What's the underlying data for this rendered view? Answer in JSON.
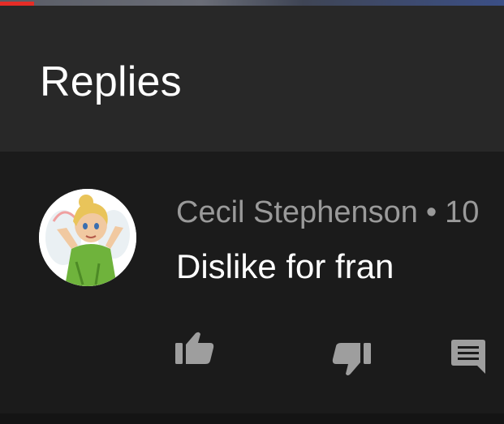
{
  "header": {
    "title": "Replies"
  },
  "reply": {
    "author": "Cecil Stephenson",
    "separator": "•",
    "time_partial": "10",
    "text": "Dislike for fran",
    "avatar_icon": "cartoon-fairy-avatar"
  },
  "actions": {
    "like_icon": "thumbs-up-icon",
    "dislike_icon": "thumbs-down-icon",
    "reply_icon": "comment-icon"
  },
  "colors": {
    "header_bg": "#282828",
    "list_bg": "#1b1b1b",
    "meta_text": "#9a9a9a",
    "body_text": "#ffffff",
    "icon": "#9e9e9e",
    "progress_red": "#e52d27"
  }
}
